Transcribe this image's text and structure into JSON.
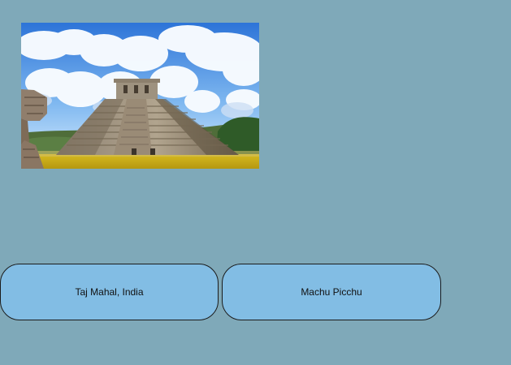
{
  "image": {
    "subject": "pyramid photo"
  },
  "options": [
    {
      "label": "Taj Mahal, India"
    },
    {
      "label": "Machu Picchu"
    }
  ],
  "colors": {
    "background": "#7fa9b9",
    "button_fill": "#82bde4",
    "button_border": "#1b1b1b",
    "text": "#111111"
  }
}
